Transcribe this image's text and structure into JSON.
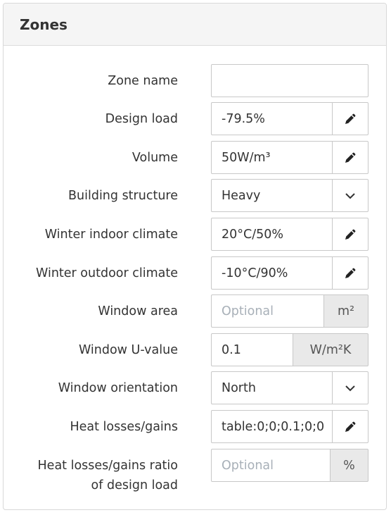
{
  "panel": {
    "title": "Zones"
  },
  "fields": {
    "zone_name": {
      "label": "Zone name",
      "value": ""
    },
    "design_load": {
      "label": "Design load",
      "value": "-79.5%",
      "button_icon": "pencil-icon"
    },
    "volume": {
      "label": "Volume",
      "value": "50W/m³",
      "button_icon": "pencil-icon"
    },
    "building_structure": {
      "label": "Building structure",
      "value": "Heavy",
      "button_icon": "chevron-down-icon"
    },
    "winter_indoor_climate": {
      "label": "Winter indoor climate",
      "value": "20°C/50%",
      "button_icon": "pencil-icon"
    },
    "winter_outdoor_climate": {
      "label": "Winter outdoor climate",
      "value": "-10°C/90%",
      "button_icon": "pencil-icon"
    },
    "window_area": {
      "label": "Window area",
      "placeholder": "Optional",
      "unit": "m²"
    },
    "window_u_value": {
      "label": "Window U-value",
      "value": "0.1",
      "unit": "W/m²K"
    },
    "window_orientation": {
      "label": "Window orientation",
      "value": "North",
      "button_icon": "chevron-down-icon"
    },
    "heat_losses_gains": {
      "label": "Heat losses/gains",
      "value": "table:0;0;0.1;0;0",
      "button_icon": "pencil-icon"
    },
    "heat_losses_gains_ratio": {
      "label_line1": "Heat losses/gains ratio",
      "label_line2": "of design load",
      "placeholder": "Optional",
      "unit": "%"
    }
  }
}
